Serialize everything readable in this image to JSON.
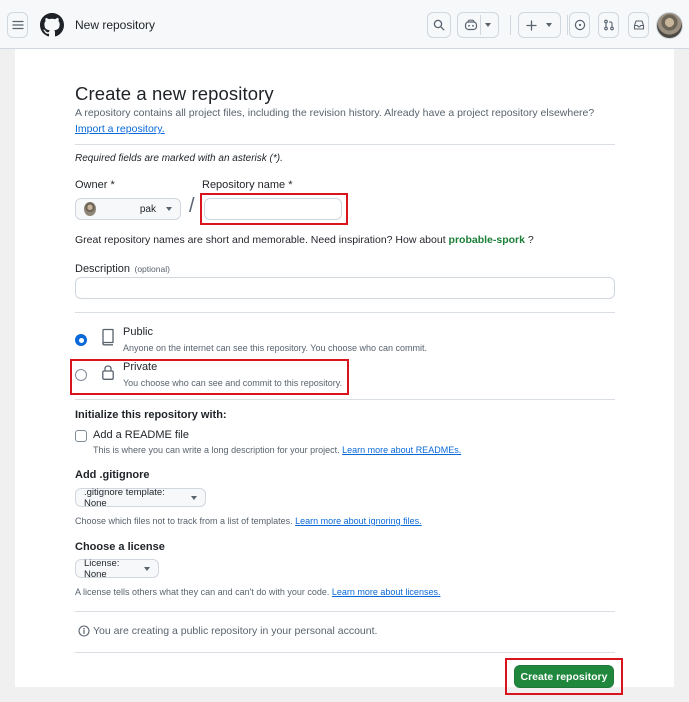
{
  "header": {
    "title": "New repository",
    "icons": [
      "hamburger-icon",
      "github-logo-icon",
      "search-icon",
      "copilot-icon",
      "plus-icon",
      "issues-icon",
      "pull-requests-icon",
      "inbox-icon"
    ]
  },
  "form": {
    "heading": "Create a new repository",
    "intro": "A repository contains all project files, including the revision history. Already have a project repository elsewhere?",
    "import_link": "Import a repository.",
    "required_note": "Required fields are marked with an asterisk (*).",
    "owner_label": "Owner *",
    "owner_value": "pak",
    "repo_name_label": "Repository name *",
    "repo_name_value": "",
    "slash": "/",
    "inspiration_prefix": "Great repository names are short and memorable. Need inspiration? How about",
    "inspiration_name": "probable-spork",
    "inspiration_suffix": "?",
    "description_label": "Description",
    "description_optional": "(optional)",
    "description_value": ""
  },
  "visibility": {
    "public_label": "Public",
    "public_desc": "Anyone on the internet can see this repository. You choose who can commit.",
    "private_label": "Private",
    "private_desc": "You choose who can see and commit to this repository.",
    "selected": "public"
  },
  "init": {
    "heading": "Initialize this repository with:",
    "readme_label": "Add a README file",
    "readme_desc": "This is where you can write a long description for your project.",
    "readme_link": "Learn more about READMEs.",
    "readme_checked": false
  },
  "gitignore": {
    "heading": "Add .gitignore",
    "select_label": ".gitignore template: None",
    "desc": "Choose which files not to track from a list of templates.",
    "link": "Learn more about ignoring files."
  },
  "license": {
    "heading": "Choose a license",
    "select_label": "License: None",
    "desc": "A license tells others what they can and can't do with your code.",
    "link": "Learn more about licenses."
  },
  "footer": {
    "notice": "You are creating a public repository in your personal account.",
    "create_button": "Create repository"
  },
  "colors": {
    "accent": "#0969da",
    "primary_button": "#1f883d",
    "highlight": "#d9141c",
    "inspiration": "#1a7f37"
  }
}
